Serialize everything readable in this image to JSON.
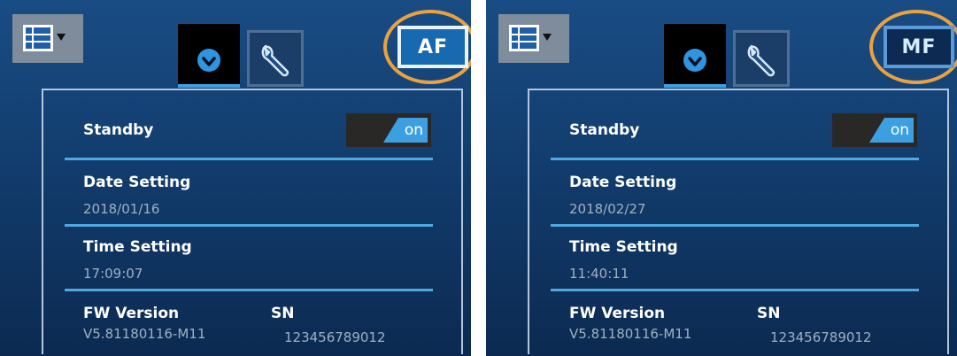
{
  "screens": [
    {
      "focus_mode": "AF",
      "standby": {
        "label": "Standby",
        "toggle": "on"
      },
      "date": {
        "label": "Date Setting",
        "value": "2018/01/16"
      },
      "time": {
        "label": "Time Setting",
        "value": "17:09:07"
      },
      "fw": {
        "label": "FW Version",
        "value": "V5.81180116-M11"
      },
      "sn": {
        "label": "SN",
        "value": "123456789012"
      }
    },
    {
      "focus_mode": "MF",
      "standby": {
        "label": "Standby",
        "toggle": "on"
      },
      "date": {
        "label": "Date Setting",
        "value": "2018/02/27"
      },
      "time": {
        "label": "Time Setting",
        "value": "11:40:11"
      },
      "fw": {
        "label": "FW Version",
        "value": "V5.81180116-M11"
      },
      "sn": {
        "label": "SN",
        "value": "123456789012"
      }
    }
  ],
  "icons": {
    "menu": "list-menu-icon",
    "clock_tab": "clock-icon",
    "settings_tab": "wrench-icon"
  },
  "colors": {
    "accent": "#3aa2e4",
    "highlight_ring": "#e8a23f",
    "background": "#123d6e"
  }
}
